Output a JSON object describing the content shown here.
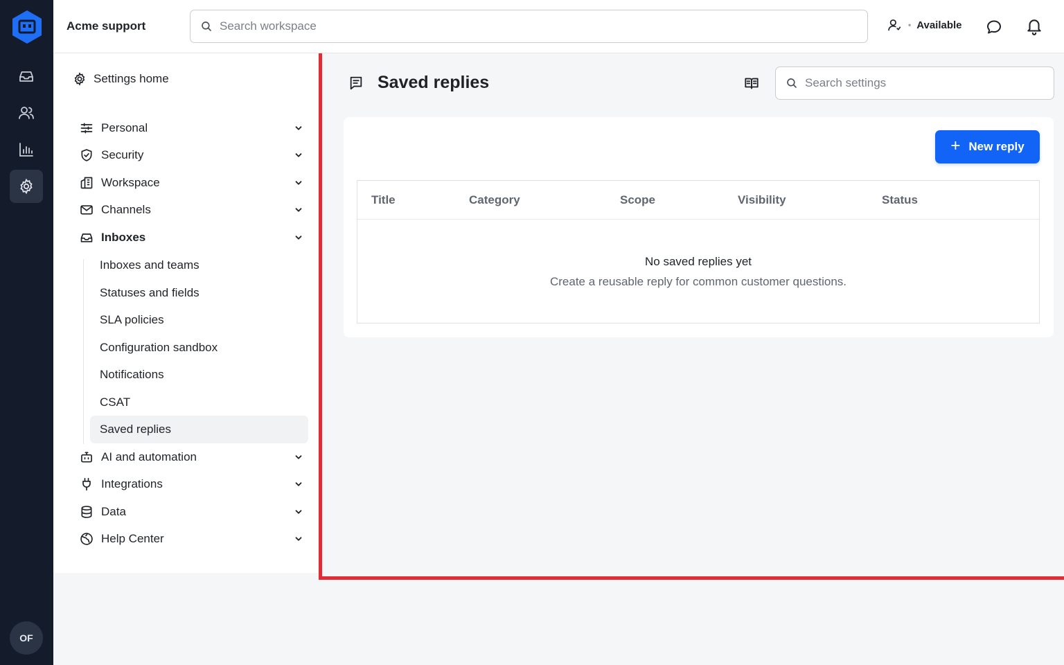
{
  "rail": {
    "avatar_initials": "OF",
    "nav": [
      "inbox-icon",
      "people-icon",
      "reports-icon",
      "settings-icon"
    ]
  },
  "header": {
    "workspace_name": "Acme support",
    "search_placeholder": "Search workspace",
    "presence_status": "Available"
  },
  "sidebar": {
    "home_label": "Settings home",
    "groups": [
      {
        "label": "Personal",
        "icon": "sliders-icon"
      },
      {
        "label": "Security",
        "icon": "shield-icon"
      },
      {
        "label": "Workspace",
        "icon": "building-icon"
      },
      {
        "label": "Channels",
        "icon": "mail-icon"
      },
      {
        "label": "Inboxes",
        "icon": "inbox-icon"
      },
      {
        "label": "AI and automation",
        "icon": "bot-icon"
      },
      {
        "label": "Integrations",
        "icon": "plug-icon"
      },
      {
        "label": "Data",
        "icon": "database-icon"
      },
      {
        "label": "Help Center",
        "icon": "globe-icon"
      }
    ],
    "inbox_items": [
      "Inboxes and teams",
      "Statuses and fields",
      "SLA policies",
      "Configuration sandbox",
      "Notifications",
      "CSAT",
      "Saved replies"
    ],
    "active_item": "Saved replies"
  },
  "main": {
    "title": "Saved replies",
    "settings_search_placeholder": "Search settings",
    "new_button_label": "New reply",
    "columns": [
      "Title",
      "Category",
      "Scope",
      "Visibility",
      "Status"
    ],
    "empty_title": "No saved replies yet",
    "empty_subtitle": "Create a reusable reply for common customer questions."
  },
  "colors": {
    "rail_bg": "#141c2b",
    "accent": "#1264f6",
    "highlight_border": "#e02c35"
  }
}
